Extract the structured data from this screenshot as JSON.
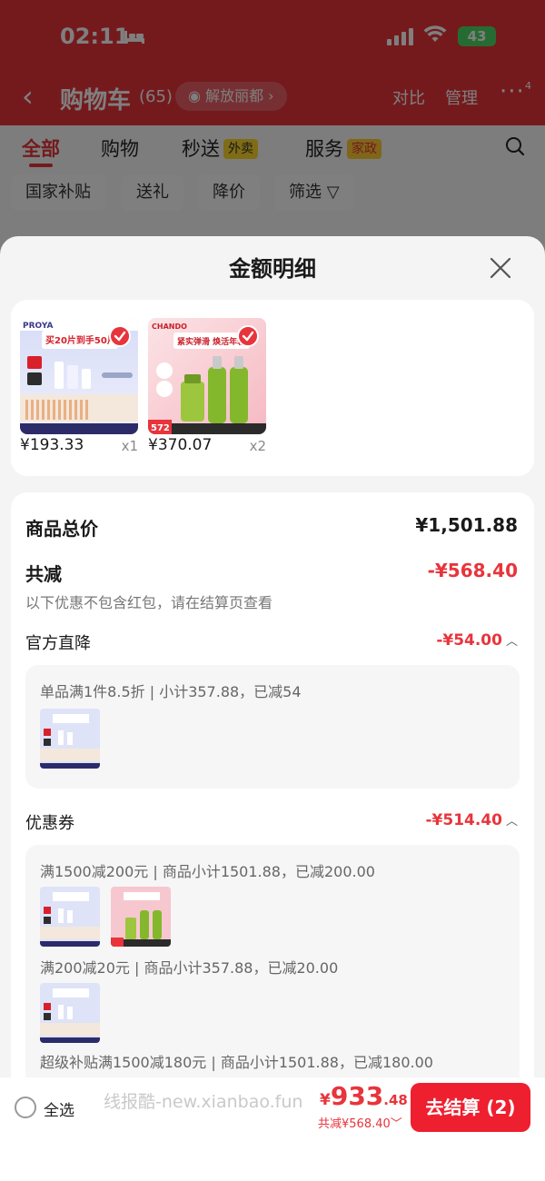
{
  "status_bar": {
    "time": "02:11",
    "battery": "43"
  },
  "header": {
    "title": "购物车",
    "count": "(65)",
    "location": "解放丽都",
    "compare": "对比",
    "manage": "管理",
    "more_badge": "4"
  },
  "tabs": [
    {
      "label": "全部"
    },
    {
      "label": "购物"
    },
    {
      "label": "秒送",
      "badge": "外卖"
    },
    {
      "label": "服务",
      "badge": "家政"
    }
  ],
  "chips": [
    "国家补贴",
    "送礼",
    "降价",
    "筛选"
  ],
  "sheet": {
    "title": "金额明细",
    "products": [
      {
        "price": "¥193.33",
        "qty": "x1",
        "brand": "PROYA",
        "promo": "买20片到手50片"
      },
      {
        "price": "¥370.07",
        "qty": "x2",
        "brand": "CHANDO",
        "promo": "紧实弹滑 焕活年轻",
        "tag": "572"
      }
    ],
    "total_label": "商品总价",
    "total_value": "¥1,501.88",
    "discount_label": "共减",
    "discount_value": "-¥568.40",
    "discount_note": "以下优惠不包含红包，请在结算页查看",
    "sections": {
      "official": {
        "label": "官方直降",
        "value": "-¥54.00",
        "rules": [
          "单品满1件8.5折 | 小计357.88，已减54"
        ]
      },
      "coupon": {
        "label": "优惠券",
        "value": "-¥514.40",
        "rules": [
          "满1500减200元 | 商品小计1501.88，已减200.00",
          "满200减20元 | 商品小计357.88，已减20.00",
          "超级补贴满1500减180元 | 商品小计1501.88，已减180.00"
        ]
      }
    }
  },
  "bottom_bar": {
    "select_all": "全选",
    "watermark": "线报酷-new.xianbao.fun",
    "currency": "¥",
    "total_int": "933",
    "total_dec": ".48",
    "discount": "共减¥568.40",
    "checkout": "去结算 (2)"
  },
  "colors": {
    "accent": "#e8343b",
    "checkout": "#ee1f2f",
    "battery": "#4cd964"
  }
}
